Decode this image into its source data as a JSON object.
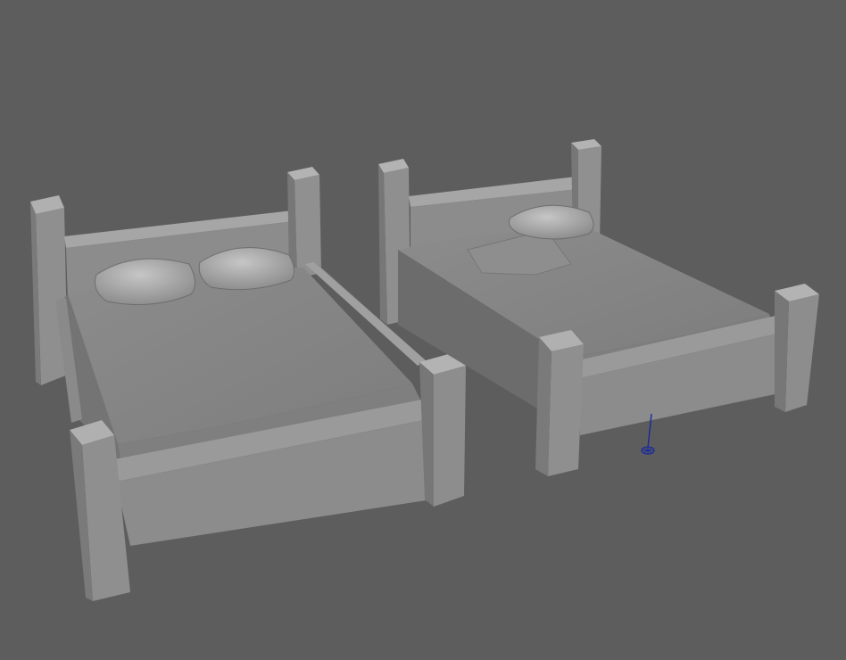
{
  "viewport": {
    "background": "#5d5d5d",
    "scene_objects": [
      "bed-left",
      "bed-right"
    ],
    "manipulator_icon": "pivot-locator-icon",
    "manipulator_color": "#1a2a9a"
  }
}
